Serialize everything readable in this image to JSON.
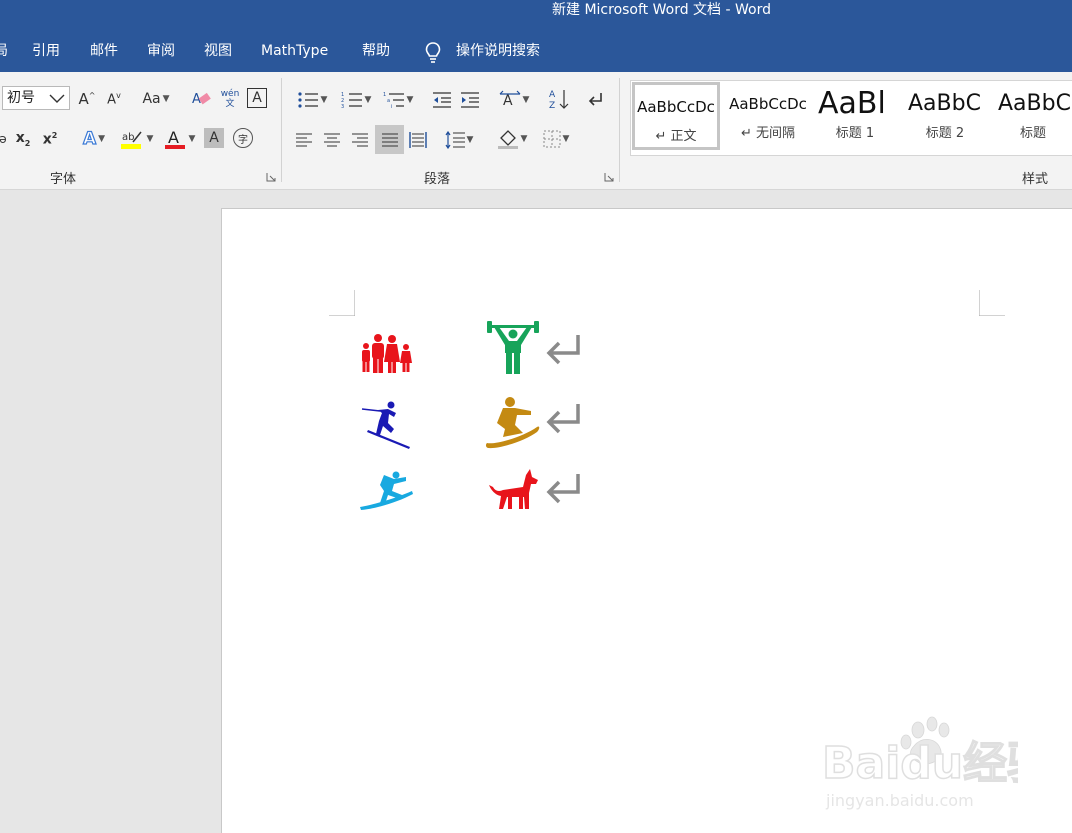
{
  "window": {
    "title": "新建 Microsoft Word 文档  -  Word"
  },
  "menu": {
    "items": [
      "局",
      "引用",
      "邮件",
      "审阅",
      "视图",
      "MathType",
      "帮助"
    ],
    "search": "操作说明搜索"
  },
  "ribbon": {
    "font_group": {
      "label": "字体",
      "font_size": "初号",
      "change_case": "Aa",
      "pinyin": "wén\n文"
    },
    "paragraph_group": {
      "label": "段落"
    },
    "styles_group": {
      "label": "样式",
      "items": [
        {
          "sample": "AaBbCcDc",
          "name": "↵ 正文",
          "selected": true
        },
        {
          "sample": "AaBbCcDc",
          "name": "↵ 无间隔",
          "selected": false
        },
        {
          "sample": "AaBl",
          "name": "标题 1",
          "selected": false
        },
        {
          "sample": "AaBbC",
          "name": "标题 2",
          "selected": false
        },
        {
          "sample": "AaBbC",
          "name": "标题",
          "selected": false
        }
      ]
    }
  },
  "document": {
    "symbols": [
      {
        "name": "family",
        "color": "#e8141b"
      },
      {
        "name": "weightlifter",
        "color": "#17a45a"
      },
      {
        "name": "skier",
        "color": "#1a1ab4"
      },
      {
        "name": "snowboarder",
        "color": "#c48a12"
      },
      {
        "name": "surfer",
        "color": "#18a9e0"
      },
      {
        "name": "dog",
        "color": "#e8141b"
      }
    ],
    "return_mark_color": "#8a8a8a"
  },
  "watermark": {
    "text": "Baidu经验",
    "url_text": "jingyan.baidu.com"
  },
  "colors": {
    "title_bar": "#2b579a",
    "ribbon_bg": "#f3f3f3",
    "workspace": "#e6e6e6"
  }
}
